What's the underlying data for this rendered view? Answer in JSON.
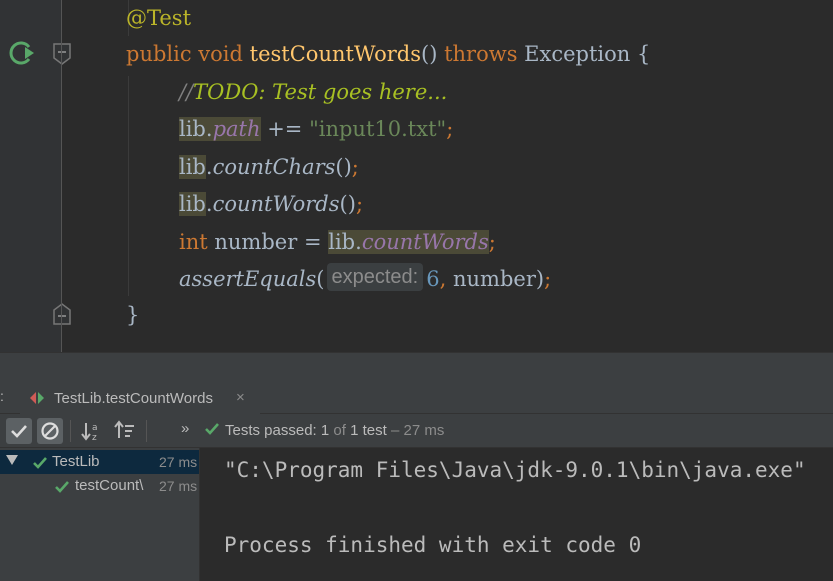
{
  "editor": {
    "lines": [
      {
        "annotation": "@Test"
      },
      {
        "kw_public": "public",
        "kw_void": "void",
        "method_name": "testCountWords",
        "parens": "()",
        "kw_throws": "throws",
        "exception": "Exception",
        "brace": "{"
      },
      {
        "comment_prefix": "//",
        "todo_text": "TODO: Test goes here..."
      },
      {
        "lib": "lib",
        "dot": ".",
        "field": "path",
        "op": "+=",
        "string": "\"input10.txt\"",
        "semi": ";"
      },
      {
        "lib": "lib",
        "dot": ".",
        "method": "countChars",
        "parens": "()",
        "semi": ";"
      },
      {
        "lib": "lib",
        "dot": ".",
        "method": "countWords",
        "parens": "()",
        "semi": ";"
      },
      {
        "kw_int": "int",
        "var": "number",
        "eq": "=",
        "lib": "lib",
        "dot": ".",
        "method": "countWords",
        "semi": ";"
      },
      {
        "method": "assertEquals",
        "open": "(",
        "hint": "expected:",
        "value": "6",
        "comma": ",",
        "arg": "number",
        "close": ")",
        "semi": ";"
      },
      {
        "brace": "}"
      }
    ]
  },
  "panel": {
    "tab": {
      "colon": ":",
      "label": "TestLib.testCountWords",
      "close": "×"
    },
    "toolbar": {
      "more": "»",
      "status_prefix": "Tests passed:",
      "passed": "1",
      "of": "of",
      "total": "1",
      "test_word": "test",
      "duration": "– 27 ms"
    },
    "tree": [
      {
        "name": "TestLib",
        "time": "27 ms"
      },
      {
        "name": "testCount\\",
        "time": "27 ms"
      }
    ],
    "console": [
      "\"C:\\Program Files\\Java\\jdk-9.0.1\\bin\\java.exe\"",
      "Process finished with exit code 0"
    ]
  },
  "colors": {
    "editor_bg": "#2b2b2b",
    "panel_bg": "#3c3f41",
    "keyword": "#cc7832",
    "annotation": "#bbb529",
    "method_decl": "#ffc66d",
    "todo": "#a8c023",
    "field": "#9876aa",
    "string": "#6a8759",
    "number": "#6897bb",
    "pass_green": "#59a869",
    "selection": "#0d293e"
  },
  "icons": [
    "run-test-icon",
    "fold-marker-icon",
    "test-class-icon",
    "check-icon",
    "toggle-passed-icon",
    "toggle-ignored-icon",
    "sort-alpha-icon",
    "sort-duration-icon",
    "expand-arrow-icon"
  ]
}
